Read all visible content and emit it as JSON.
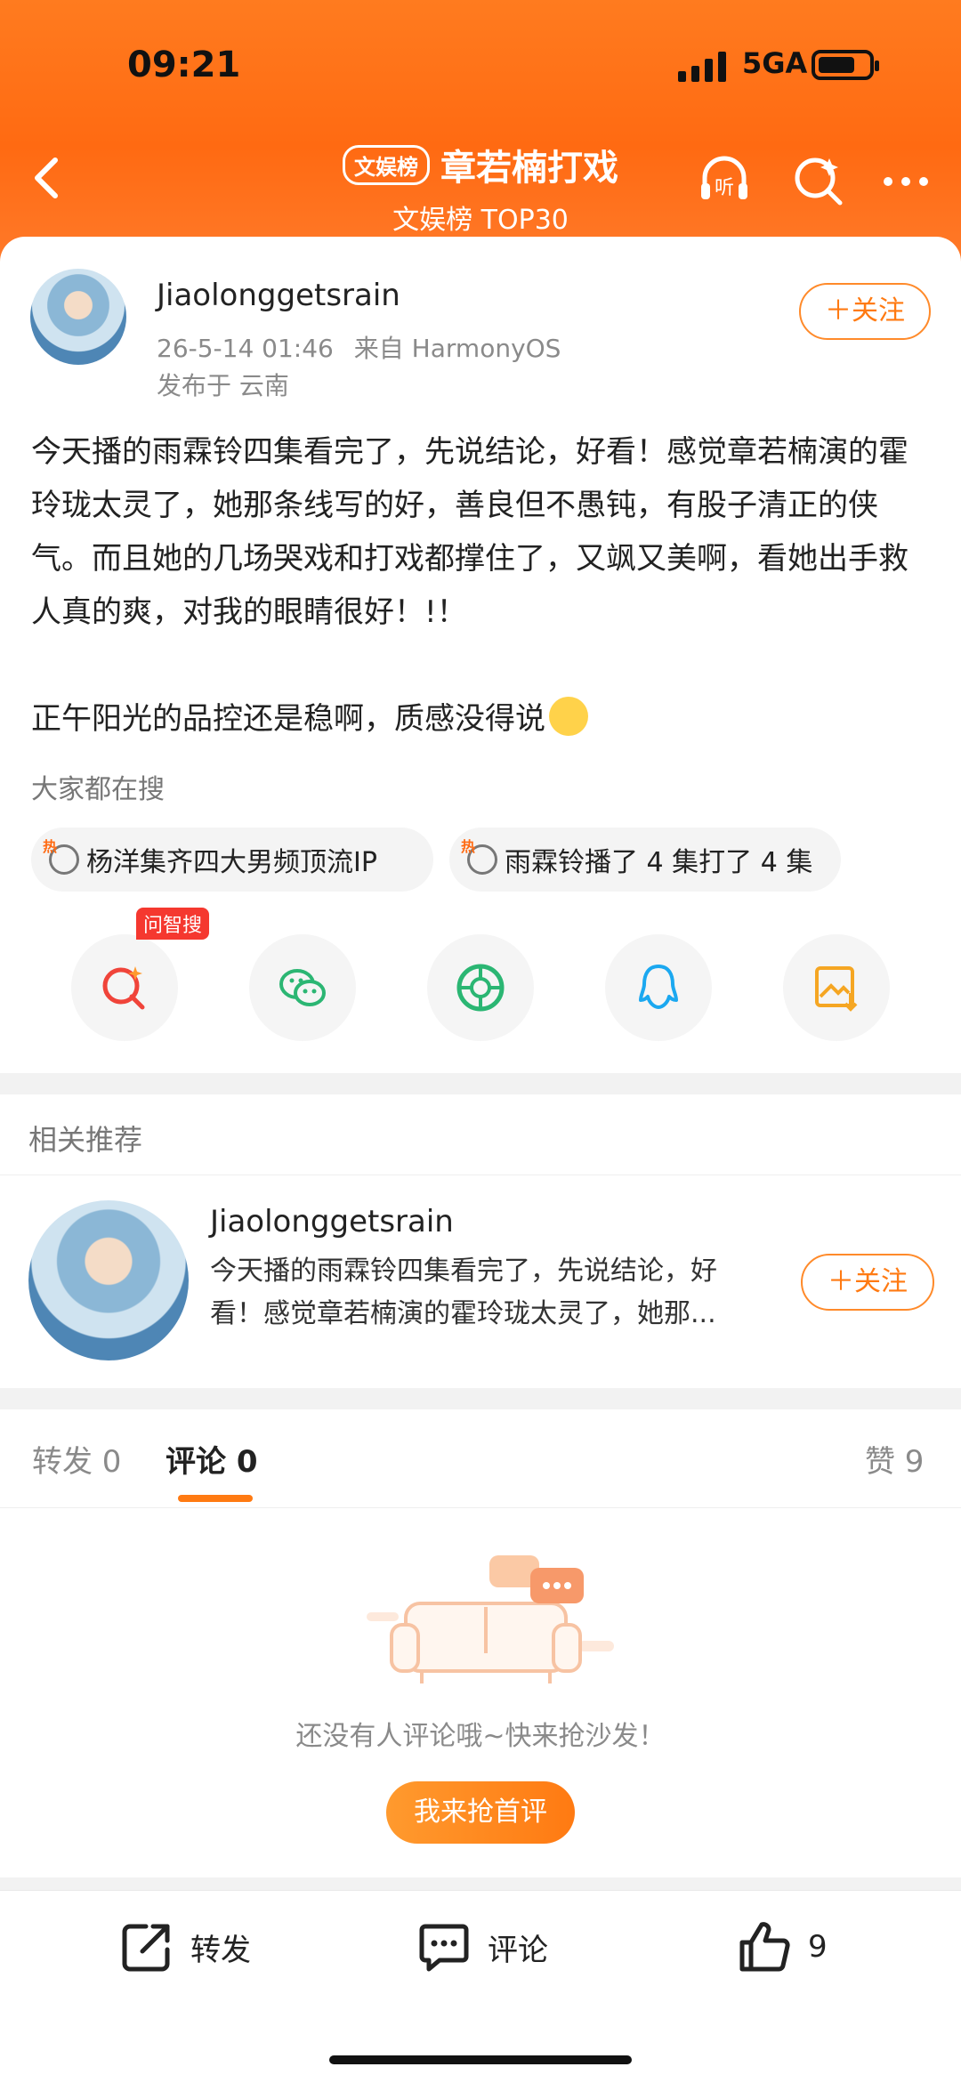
{
  "status_bar": {
    "time": "09:21",
    "network": "5GA"
  },
  "nav": {
    "badge": "文娱榜",
    "title": "章若楠打戏",
    "subtitle": "文娱榜 TOP30",
    "icons": [
      "back-icon",
      "listen-icon",
      "search-icon",
      "more-icon"
    ]
  },
  "post": {
    "author": "Jiaolonggetsrain",
    "time": "26-5-14 01:46",
    "source": "来自 HarmonyOS",
    "location": "发布于 云南",
    "follow_label": "＋关注",
    "paragraph1": "今天播的雨霖铃四集看完了，先说结论，好看！感觉章若楠演的霍玲珑太灵了，她那条线写的好，善良但不愚钝，有股子清正的侠气。而且她的几场哭戏和打戏都撑住了，又飒又美啊，看她出手救人真的爽，对我的眼睛很好！!！",
    "paragraph2": "正午阳光的品控还是稳啊，质感没得说"
  },
  "search": {
    "label": "大家都在搜",
    "chips": [
      "杨洋集齐四大男频顶流IP",
      "雨霖铃播了 4 集打了 4 集"
    ]
  },
  "share": {
    "badge": "问智搜",
    "icons": [
      "ai-search-icon",
      "wechat-icon",
      "moments-icon",
      "qq-icon",
      "save-image-icon"
    ]
  },
  "related": {
    "label": "相关推荐",
    "author": "Jiaolonggetsrain",
    "excerpt": "今天播的雨霖铃四集看完了，先说结论，好看！感觉章若楠演的霍玲珑太灵了，她那...",
    "follow_label": "＋关注"
  },
  "tabs": {
    "repost": "转发 0",
    "comment": "评论 0",
    "like": "赞 9"
  },
  "empty": {
    "text": "还没有人评论哦~快来抢沙发！",
    "button": "我来抢首评"
  },
  "bottom_bar": {
    "repost": "转发",
    "comment": "评论",
    "like_count": "9"
  },
  "colors": {
    "accent": "#ff7a12",
    "header": "#ff6a12"
  }
}
